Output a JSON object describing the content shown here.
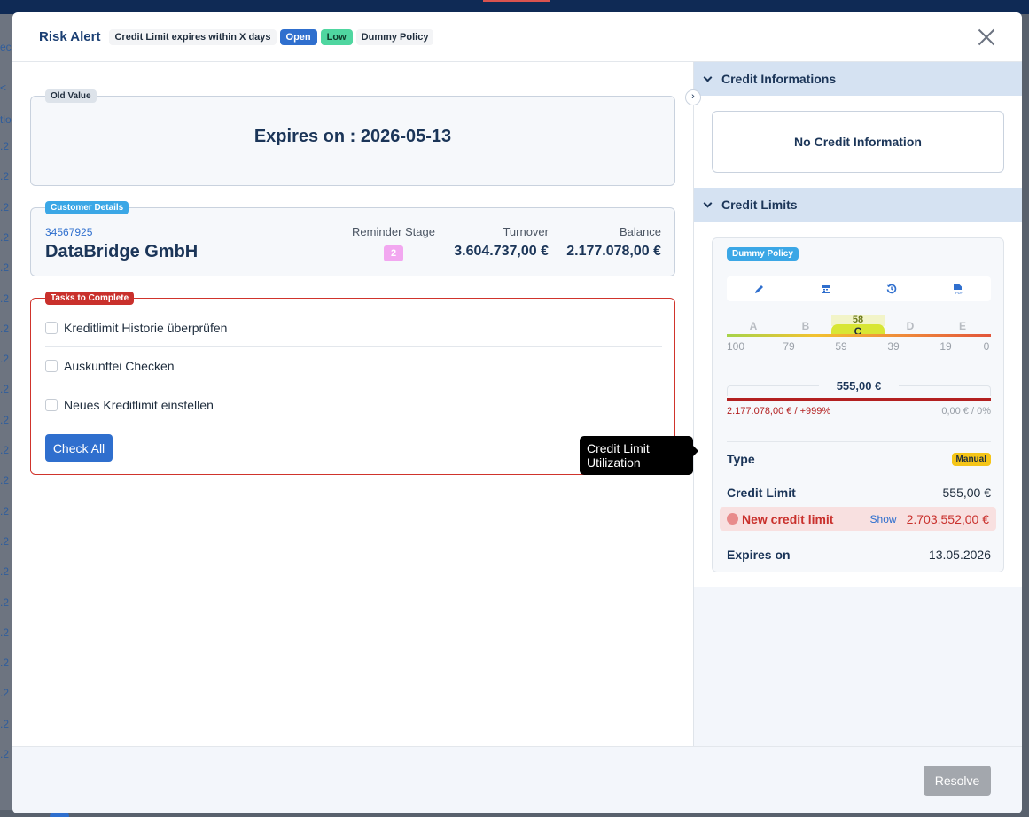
{
  "background": {
    "left_column_fragments": [
      "ec",
      "<",
      "tio",
      ".2",
      ".2",
      ".2",
      ".2",
      ".2",
      ".2",
      ".2",
      ".2",
      ".2",
      ".2",
      ".2",
      ".2",
      ".2",
      ".2",
      ".2",
      ".2",
      ".2",
      ".2",
      ".2",
      ".2",
      ".2"
    ],
    "pagination": [
      "1",
      "2"
    ]
  },
  "header": {
    "title": "Risk Alert",
    "alert_type": "Credit Limit expires within X days",
    "status": "Open",
    "severity": "Low",
    "policy": "Dummy Policy",
    "close_icon": "close-icon"
  },
  "old_value": {
    "legend": "Old Value",
    "expires_text": "Expires on : 2026-05-13"
  },
  "customer": {
    "legend": "Customer Details",
    "id": "34567925",
    "name": "DataBridge GmbH",
    "reminder_stage_label": "Reminder Stage",
    "reminder_stage": "2",
    "turnover_label": "Turnover",
    "turnover": "3.604.737,00 €",
    "balance_label": "Balance",
    "balance": "2.177.078,00 €"
  },
  "tasks": {
    "legend": "Tasks to Complete",
    "items": [
      {
        "label": "Kreditlimit Historie überprüfen",
        "checked": false
      },
      {
        "label": "Auskunftei Checken",
        "checked": false
      },
      {
        "label": "Neues Kreditlimit einstellen",
        "checked": false
      }
    ],
    "check_all_label": "Check All"
  },
  "tooltip": {
    "text": "Credit Limit Utilization"
  },
  "right_pane": {
    "credit_info": {
      "title": "Credit Informations",
      "empty_text": "No Credit Information"
    },
    "credit_limits": {
      "title": "Credit Limits",
      "policy_chip": "Dummy Policy",
      "icons": [
        "pencil-icon",
        "calendar-icon",
        "history-icon",
        "pdf-icon"
      ],
      "grades": [
        "A",
        "B",
        "C",
        "D",
        "E"
      ],
      "scale": [
        "100",
        "79",
        "59",
        "39",
        "19",
        "0"
      ],
      "current_grade": "C",
      "current_score": "58",
      "utilization": {
        "amount": "555,00 €",
        "left_text": "2.177.078,00 € / +999%",
        "right_text": "0,00 € / 0%",
        "fill_fraction": 1.0
      },
      "details": {
        "type_label": "Type",
        "type_value": "Manual",
        "credit_limit_label": "Credit Limit",
        "credit_limit_value": "555,00 €",
        "new_limit_label": "New credit limit",
        "new_limit_show": "Show",
        "new_limit_value": "2.703.552,00 €",
        "expires_label": "Expires on",
        "expires_value": "13.05.2026"
      }
    }
  },
  "footer": {
    "resolve_label": "Resolve"
  },
  "colors": {
    "primary": "#2f6fce",
    "danger": "#c9302c",
    "info": "#3ba7e6",
    "success": "#4fd6a0",
    "warning": "#f5c518"
  }
}
